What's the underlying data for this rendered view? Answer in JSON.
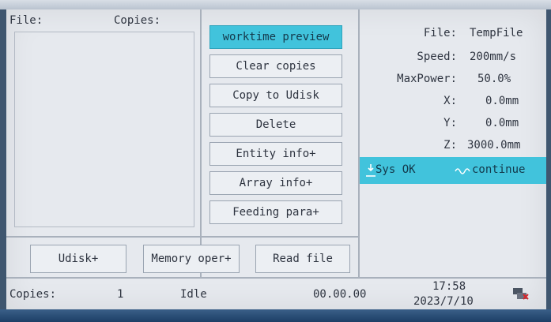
{
  "left_panel": {
    "file_label": "File:",
    "copies_label": "Copies:"
  },
  "menu_buttons": [
    {
      "label": "worktime preview",
      "active": true
    },
    {
      "label": "Clear copies"
    },
    {
      "label": "Copy to Udisk"
    },
    {
      "label": "Delete"
    },
    {
      "label": "Entity info+"
    },
    {
      "label": "Array info+"
    },
    {
      "label": "Feeding para+"
    }
  ],
  "bottom_buttons": {
    "udisk": "Udisk+",
    "memory": "Memory oper+",
    "read": "Read file"
  },
  "info": {
    "file_label": "File:",
    "file_value": "TempFile",
    "speed_label": "Speed:",
    "speed_value": "200mm/s",
    "maxpower_label": "MaxPower:",
    "maxpower_value": "50.0%",
    "x_label": "X:",
    "x_value": "0.0mm",
    "y_label": "Y:",
    "y_value": "0.0mm",
    "z_label": "Z:",
    "z_value": "3000.0mm"
  },
  "status": {
    "sys": "Sys OK",
    "mode": "continue",
    "colors": {
      "accent": "#41c3dc"
    }
  },
  "footer": {
    "copies_label": "Copies:",
    "copies_value": "1",
    "state": "Idle",
    "elapsed": "00.00.00",
    "time": "17:58",
    "date": "2023/7/10",
    "icon": "network-disconnected-icon"
  }
}
